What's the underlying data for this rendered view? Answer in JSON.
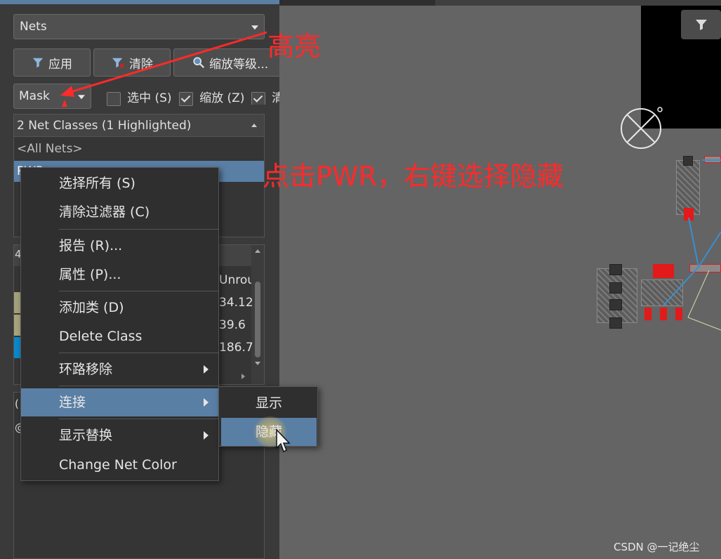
{
  "panel": {
    "filter_select": "Nets",
    "buttons": {
      "apply": "应用",
      "clear": "清除",
      "zoom": "缩放等级..."
    },
    "mode_select": "Mask",
    "checkboxes": {
      "select": "选中 (S)",
      "zoom": "缩放 (Z)",
      "clear_existing": "清"
    },
    "net_classes_header": "2 Net Classes (1 Highlighted)",
    "net_classes": [
      "<All Nets>",
      "PWR"
    ],
    "nets_table_header": "Unrou",
    "nets_table_values": [
      "34.12",
      "39.6",
      "186.7"
    ],
    "row_colors": [
      "#a4a27a",
      "#a7a57d",
      "#0b87c9"
    ],
    "left_stub_texts": [
      "4",
      "(",
      "@"
    ]
  },
  "context_menu": {
    "items": [
      {
        "label": "选择所有 (S)"
      },
      {
        "label": "清除过滤器 (C)"
      },
      {
        "label": "报告 (R)..."
      },
      {
        "label": "属性 (P)..."
      },
      {
        "label": "添加类 (D)"
      },
      {
        "label": "Delete Class"
      },
      {
        "label": "环路移除"
      },
      {
        "label": "连接"
      },
      {
        "label": "显示替换"
      },
      {
        "label": "Change Net Color"
      }
    ],
    "submenu": [
      {
        "label": "显示"
      },
      {
        "label": "隐藏"
      }
    ]
  },
  "annotations": {
    "highlight": "高亮",
    "instruction": "点击PWR，右键选择隐藏"
  },
  "watermark": "CSDN @一记绝尘",
  "colors": {
    "accent": "#5a7fa5",
    "annotation": "#ff2a2a",
    "pad_red": "#e21a1a"
  },
  "icons": [
    "funnel-icon",
    "funnel-clear-icon",
    "magnifier-icon",
    "chevron-down-icon",
    "chevron-right-icon",
    "mouse-cursor-icon"
  ]
}
